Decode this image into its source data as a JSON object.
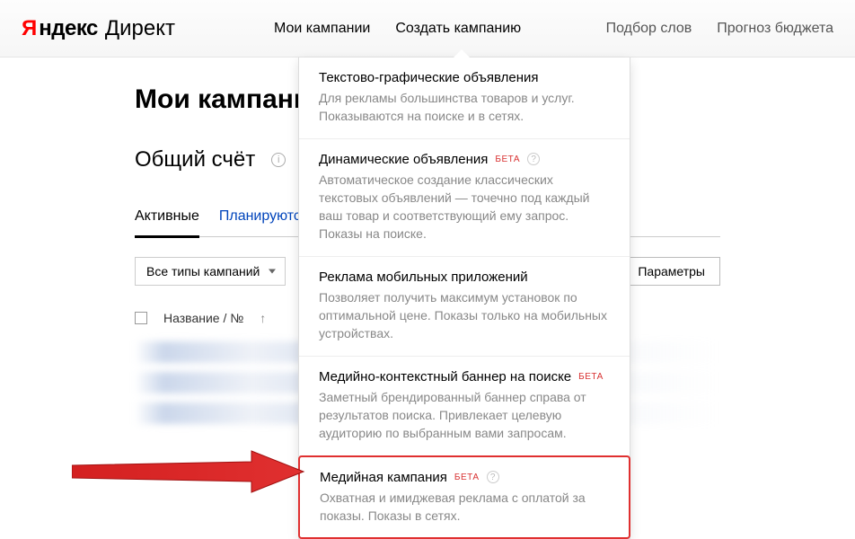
{
  "logo": {
    "ya": "Я",
    "ndex": "ндекс",
    "direct": "Директ"
  },
  "nav": {
    "my_campaigns": "Мои кампании",
    "create_campaign": "Создать кампанию",
    "word_selection": "Подбор слов",
    "budget_forecast": "Прогноз бюджета"
  },
  "page": {
    "title": "Мои кампании",
    "balance_label": "Общий счёт"
  },
  "tabs": {
    "active": "Активные",
    "planned": "Планируются"
  },
  "filters": {
    "all_types": "Все типы кампаний",
    "params_btn": "Параметры"
  },
  "table": {
    "name_col": "Название / №",
    "sort_arrow": "↑"
  },
  "badges": {
    "beta": "БЕТА"
  },
  "dropdown": [
    {
      "title": "Текстово-графические объявления",
      "desc": "Для рекламы большинства товаров и услуг. Показываются на поиске и в сетях.",
      "beta": false,
      "help": false
    },
    {
      "title": "Динамические объявления",
      "desc": "Автоматическое создание классических текстовых объявлений — точечно под каждый ваш товар и соответствующий ему запрос. Показы на поиске.",
      "beta": true,
      "help": true
    },
    {
      "title": "Реклама мобильных приложений",
      "desc": "Позволяет получить максимум установок по оптимальной цене. Показы только на мобильных устройствах.",
      "beta": false,
      "help": false
    },
    {
      "title": "Медийно-контекстный баннер на поиске",
      "desc": "Заметный брендированный баннер справа от результатов поиска. Привлекает целевую аудиторию по выбранным вами запросам.",
      "beta": true,
      "help": false
    },
    {
      "title": "Медийная кампания",
      "desc": "Охватная и имиджевая реклама с оплатой за показы. Показы в сетях.",
      "beta": true,
      "help": true
    }
  ]
}
